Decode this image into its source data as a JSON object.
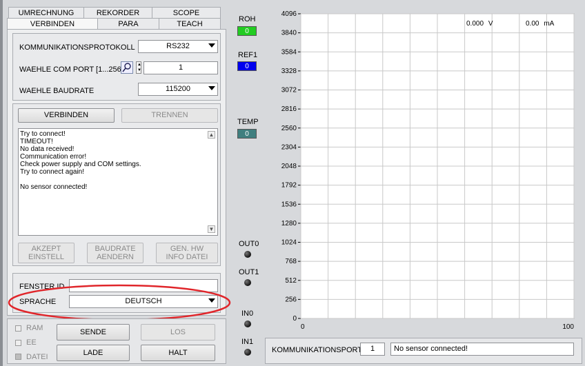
{
  "tabs": {
    "row1": [
      "UMRECHNUNG",
      "REKORDER",
      "SCOPE"
    ],
    "row2": [
      "VERBINDEN",
      "PARA",
      "TEACH"
    ]
  },
  "settings": {
    "protocol_label": "KOMMUNIKATIONSPROTOKOLL",
    "protocol_value": "RS232",
    "comport_label": "WAEHLE COM PORT [1...256]",
    "comport_value": "1",
    "baud_label": "WAEHLE BAUDRATE",
    "baud_value": "115200"
  },
  "connect": {
    "connect_label": "VERBINDEN",
    "disconnect_label": "TRENNEN"
  },
  "log_lines": [
    "Try to connect!",
    "TIMEOUT!",
    "No data received!",
    "Communication error!",
    "Check power supply and COM settings.",
    "Try to connect again!",
    "",
    "No sensor connected!"
  ],
  "actions": {
    "accept_l1": "AKZEPT",
    "accept_l2": "EINSTELL",
    "baud_change_l1": "BAUDRATE",
    "baud_change_l2": "AENDERN",
    "hwinfo_l1": "GEN. HW",
    "hwinfo_l2": "INFO DATEI"
  },
  "window": {
    "id_label": "FENSTER ID",
    "id_value": "",
    "language_label": "SPRACHE",
    "language_value": "DEUTSCH"
  },
  "bottom": {
    "ram_label": "RAM",
    "ee_label": "EE",
    "file_label": "DATEI",
    "send_label": "SENDE",
    "load_label": "LADE",
    "go_label": "LOS",
    "halt_label": "HALT"
  },
  "indicators": {
    "roh_label": "ROH",
    "roh_value": "0",
    "roh_color": "#22cc22",
    "ref1_label": "REF1",
    "ref1_value": "0",
    "ref1_color": "#0000ee",
    "temp_label": "TEMP",
    "temp_value": "0",
    "temp_color": "#3f7f7f",
    "out0_label": "OUT0",
    "out1_label": "OUT1",
    "in0_label": "IN0",
    "in1_label": "IN1"
  },
  "chart_data": {
    "type": "line",
    "title": "",
    "xlabel": "",
    "ylabel": "",
    "xlim": [
      0,
      100
    ],
    "ylim": [
      0,
      4096
    ],
    "x_ticks": [
      "0",
      "100"
    ],
    "y_ticks": [
      "0",
      "256",
      "512",
      "768",
      "1024",
      "1280",
      "1536",
      "1792",
      "2048",
      "2304",
      "2560",
      "2816",
      "3072",
      "3328",
      "3584",
      "3840",
      "4096"
    ],
    "grid": true,
    "series": [],
    "readouts": {
      "voltage_value": "0.000",
      "voltage_unit": "V",
      "current_value": "0.00",
      "current_unit": "mA"
    }
  },
  "status": {
    "port_label": "KOMMUNIKATIONSPORT",
    "port_value": "1",
    "message": "No sensor connected!"
  },
  "annotation_color": "#e0252a"
}
